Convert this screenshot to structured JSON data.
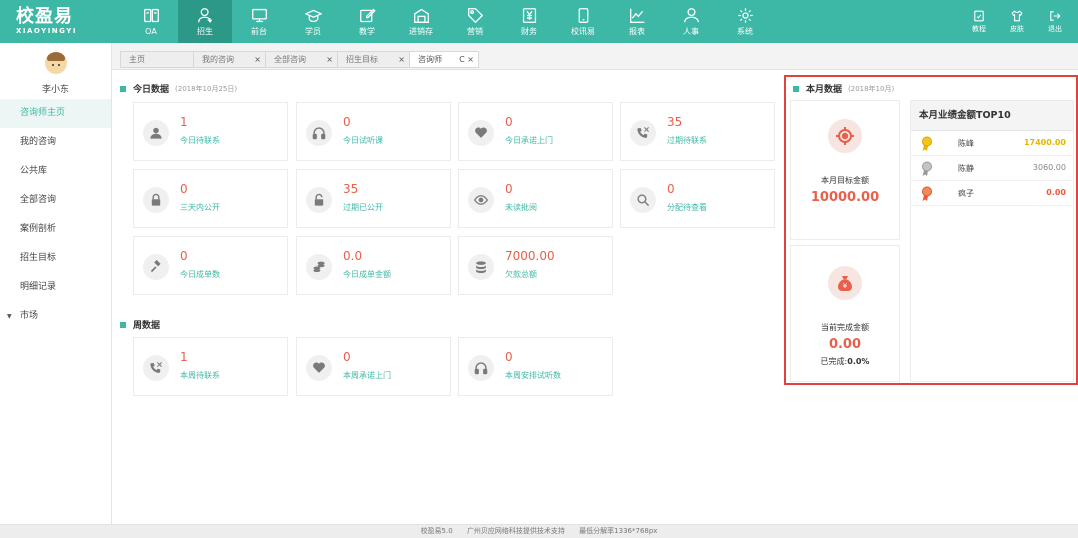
{
  "app": {
    "logo_main": "校盈易",
    "logo_sub": "XIAOYINGYI"
  },
  "topnav": [
    {
      "label": "OA",
      "icon": "book-icon"
    },
    {
      "label": "招生",
      "icon": "user-add-icon"
    },
    {
      "label": "前台",
      "icon": "monitor-icon"
    },
    {
      "label": "学员",
      "icon": "graduation-cap-icon"
    },
    {
      "label": "教学",
      "icon": "edit-doc-icon"
    },
    {
      "label": "进销存",
      "icon": "warehouse-icon"
    },
    {
      "label": "营销",
      "icon": "tag-icon"
    },
    {
      "label": "财务",
      "icon": "yuan-icon"
    },
    {
      "label": "校讯易",
      "icon": "phone-icon"
    },
    {
      "label": "报表",
      "icon": "line-chart-icon"
    },
    {
      "label": "人事",
      "icon": "people-icon"
    },
    {
      "label": "系统",
      "icon": "gear-icon"
    }
  ],
  "topnav_right": [
    {
      "label": "教程",
      "icon": "tutorial-icon"
    },
    {
      "label": "皮肤",
      "icon": "shirt-icon"
    },
    {
      "label": "退出",
      "icon": "logout-icon"
    }
  ],
  "sidebar": {
    "user_name": "李小东",
    "items": [
      {
        "label": "咨询师主页"
      },
      {
        "label": "我的咨询"
      },
      {
        "label": "公共库"
      },
      {
        "label": "全部咨询"
      },
      {
        "label": "案例剖析"
      },
      {
        "label": "招生目标"
      },
      {
        "label": "明细记录"
      },
      {
        "label": "市场"
      }
    ]
  },
  "tabs": [
    {
      "label": "主页",
      "close": ""
    },
    {
      "label": "我的咨询",
      "close": "×"
    },
    {
      "label": "全部咨询",
      "close": "×"
    },
    {
      "label": "招生目标",
      "close": "×"
    },
    {
      "label": "咨询师",
      "close": "C ×"
    }
  ],
  "today": {
    "title": "今日数据",
    "date": "(2018年10月25日)",
    "cards": [
      {
        "value": "1",
        "label": "今日待联系",
        "icon": "person-icon"
      },
      {
        "value": "0",
        "label": "今日试听课",
        "icon": "headphones-icon"
      },
      {
        "value": "0",
        "label": "今日承诺上门",
        "icon": "heart-icon"
      },
      {
        "value": "35",
        "label": "过期待联系",
        "icon": "phone-call-icon"
      },
      {
        "value": "0",
        "label": "三天内公开",
        "icon": "lock-icon"
      },
      {
        "value": "35",
        "label": "过期已公开",
        "icon": "unlock-icon"
      },
      {
        "value": "0",
        "label": "未读批阅",
        "icon": "eye-icon"
      },
      {
        "value": "0",
        "label": "分配待查看",
        "icon": "search-icon"
      },
      {
        "value": "0",
        "label": "今日成单数",
        "icon": "gavel-icon"
      },
      {
        "value": "0.0",
        "label": "今日成单金额",
        "icon": "coins-icon"
      },
      {
        "value": "7000.00",
        "label": "欠款总额",
        "icon": "database-icon"
      }
    ]
  },
  "week": {
    "title": "周数据",
    "cards": [
      {
        "value": "1",
        "label": "本周待联系",
        "icon": "phone-call-icon"
      },
      {
        "value": "0",
        "label": "本周承诺上门",
        "icon": "heart-icon"
      },
      {
        "value": "0",
        "label": "本周安排试听数",
        "icon": "headphones-icon"
      }
    ]
  },
  "month": {
    "title": "本月数据",
    "date": "(2018年10月)",
    "target_label": "本月目标金额",
    "target_value": "10000.00",
    "done_label": "当前完成金额",
    "done_value": "0.00",
    "done_pct_label": "已完成:",
    "done_pct_value": "0.0%",
    "top10_title": "本月业绩金额TOP10",
    "top10": [
      {
        "name": "陈峰",
        "amount": "17400.00",
        "medal": "gold"
      },
      {
        "name": "陈静",
        "amount": "3060.00",
        "medal": "silver"
      },
      {
        "name": "疯子",
        "amount": "0.00",
        "medal": "bronze"
      }
    ]
  },
  "footer": {
    "version": "校盈易5.0",
    "support": "广州贝应网络科技提供技术支持",
    "resolution": "最低分解率1336*768px"
  },
  "colors": {
    "brand": "#3eb8a6",
    "number": "#e8604c",
    "highlight_border": "#e0423d",
    "gold": "#e8b400",
    "silver": "#9a9a9a",
    "bronze": "#f05a3a"
  }
}
